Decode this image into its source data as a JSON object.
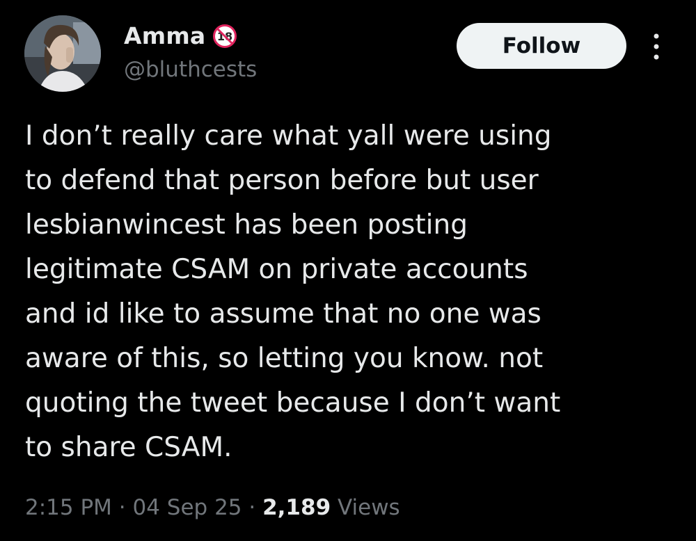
{
  "tweet": {
    "author": {
      "display_name": "Amma",
      "handle": "@bluthcests",
      "badge_icon": "no-under-18-icon"
    },
    "follow_label": "Follow",
    "more_icon": "more-vertical-icon",
    "text_lines": [
      "I don’t really care what yall were using",
      "to defend that person before but user",
      "lesbianwincest has been posting",
      "legitimate CSAM on private accounts",
      "and id like to assume that no one was",
      "aware of this, so letting you know. not",
      "quoting the tweet because I don’t want",
      "to share CSAM."
    ],
    "time": "2:15 PM",
    "separator": " · ",
    "date": "04 Sep 25",
    "views_count": "2,189",
    "views_label": " Views"
  },
  "colors": {
    "background": "#000000",
    "primary_text": "#e7e9ea",
    "secondary_text": "#71767b",
    "follow_bg": "#eff3f4",
    "follow_text": "#0f1419",
    "badge_red": "#e0245e"
  }
}
